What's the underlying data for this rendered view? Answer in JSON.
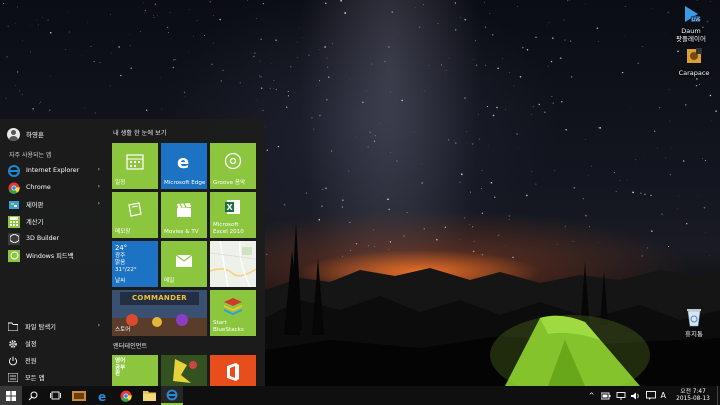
{
  "desktop": {
    "icons": [
      {
        "label": "Daum\n팟플레이어",
        "icon": "potplayer-icon"
      },
      {
        "label": "Carapace",
        "icon": "carapace-icon"
      },
      {
        "label": "휴지통",
        "icon": "recycle-bin-icon"
      }
    ]
  },
  "start_menu": {
    "user_name": "하영훈",
    "frequent_label": "자주 사용되는 앱",
    "apps": [
      {
        "label": "Internet Explorer",
        "icon": "internet-explorer-icon",
        "has_arrow": true,
        "color": "#1e88d6"
      },
      {
        "label": "Chrome",
        "icon": "chrome-icon",
        "has_arrow": true,
        "color": "#e53935"
      },
      {
        "label": "제어판",
        "icon": "control-panel-icon",
        "has_arrow": true,
        "color": "#3aa0d8"
      },
      {
        "label": "계산기",
        "icon": "calculator-icon",
        "has_arrow": false,
        "color": "#8cc63e"
      },
      {
        "label": "3D Builder",
        "icon": "3d-builder-icon",
        "has_arrow": false,
        "color": "#3b3b3b"
      },
      {
        "label": "Windows 피드백",
        "icon": "feedback-icon",
        "has_arrow": false,
        "color": "#8cc63e"
      }
    ],
    "bottom": [
      {
        "label": "파일 탐색기",
        "icon": "folder-icon",
        "has_arrow": true
      },
      {
        "label": "설정",
        "icon": "gear-icon",
        "has_arrow": false
      },
      {
        "label": "전원",
        "icon": "power-icon",
        "has_arrow": false
      },
      {
        "label": "모든 앱",
        "icon": "all-apps-icon",
        "has_arrow": false
      }
    ],
    "tile_groups": [
      {
        "label": "내 생활 한 눈에 보기"
      },
      {
        "label": "엔터테인먼트"
      }
    ],
    "tiles": {
      "calendar": {
        "label": "일정"
      },
      "edge": {
        "label": "Microsoft Edge"
      },
      "groove": {
        "label": "Groove 음악"
      },
      "notes": {
        "label": "메모장"
      },
      "movies": {
        "label": "Movies & TV"
      },
      "excel": {
        "label": "Microsoft Excel 2010"
      },
      "weather": {
        "temp": "24°",
        "line1": "광주",
        "line2": "맑음",
        "range": "31°/22°",
        "label": "날씨"
      },
      "mail": {
        "label": "메일"
      },
      "maps": {
        "label": ""
      },
      "game": {
        "label": "스토어",
        "title": "COMMANDER"
      },
      "bluestacks": {
        "label": "Start BlueStacks"
      },
      "ent1": {
        "text": "영어\n공부\n판"
      },
      "ent2": {
        "label": ""
      },
      "office": {
        "label": ""
      }
    }
  },
  "taskbar": {
    "clock_time": "오전 7:47",
    "clock_date": "2015-08-13",
    "ime_label": "A",
    "accent": "#8cc63e"
  }
}
